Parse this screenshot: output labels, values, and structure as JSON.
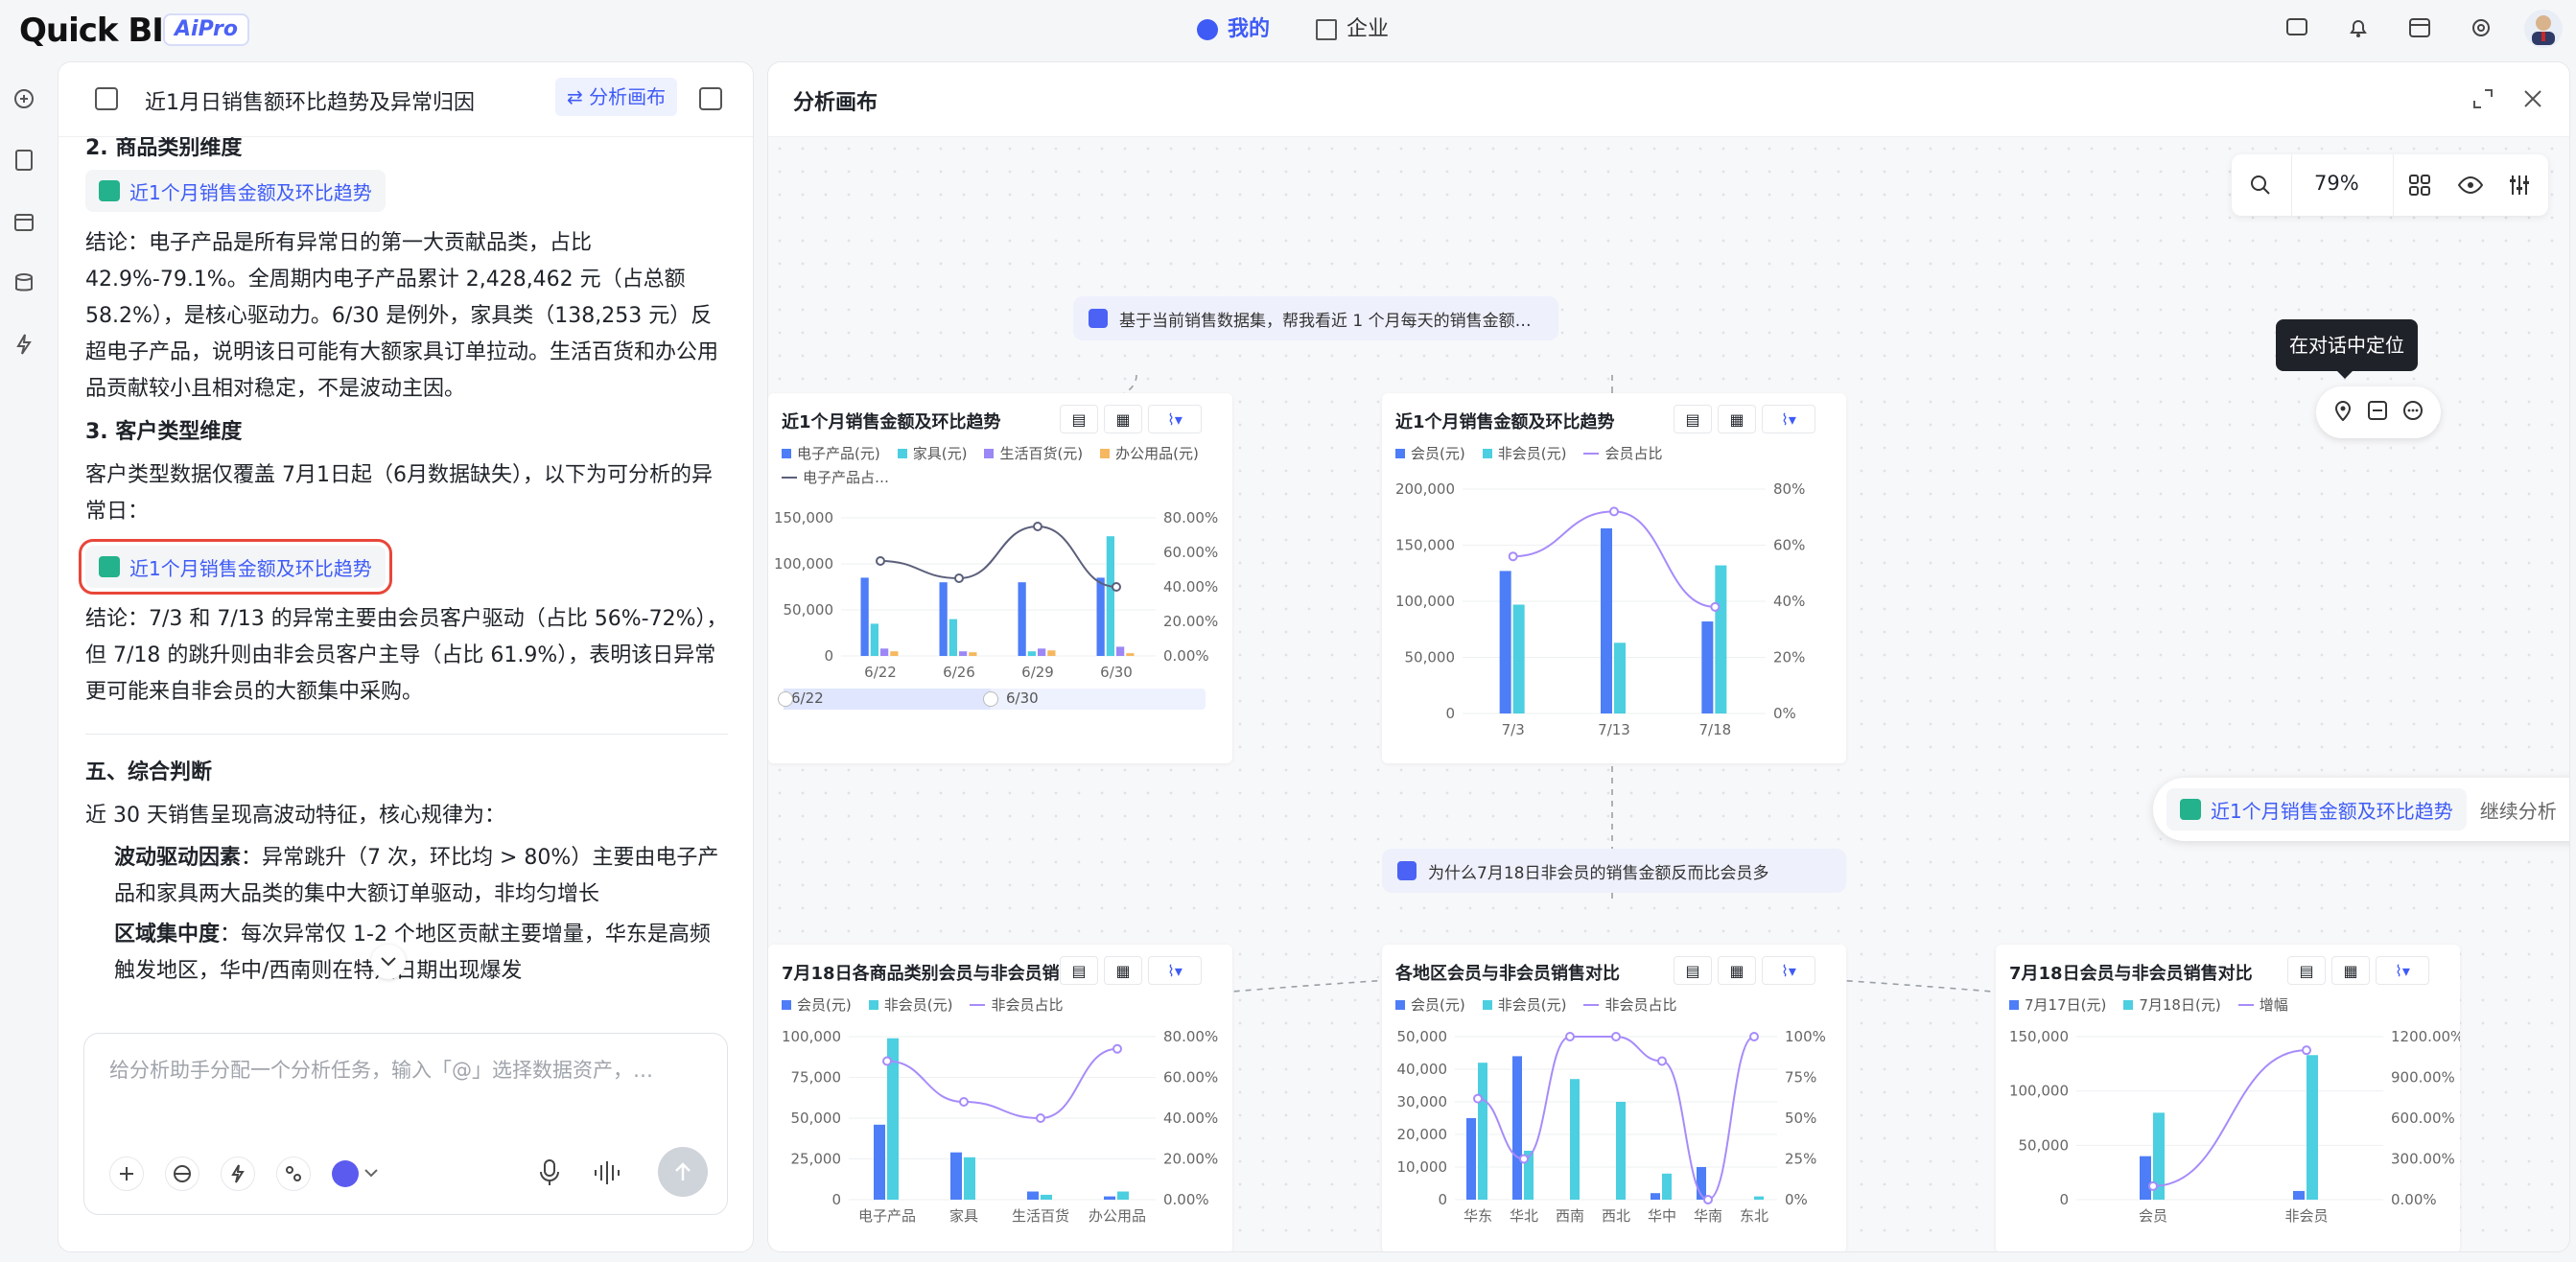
{
  "topbar": {
    "logo": "Quick BI",
    "badge": "AiPro",
    "tabs": [
      {
        "label": "我的",
        "active": true
      },
      {
        "label": "企业",
        "active": false
      }
    ],
    "colors": {
      "accent": "#3f5bf6"
    }
  },
  "chat": {
    "title": "近1月日销售额环比趋势及异常归因",
    "canvas_button": "分析画布",
    "sec2_heading": "2. 商品类别维度",
    "chip1": "近1个月销售金额及环比趋势",
    "p1": "结论：电子产品是所有异常日的第一大贡献品类，占比 42.9%-79.1%。全周期内电子产品累计 2,428,462 元（占总额 58.2%），是核心驱动力。6/30 是例外，家具类（138,253 元）反超电子产品，说明该日可能有大额家具订单拉动。生活百货和办公用品贡献较小且相对稳定，不是波动主因。",
    "sec3_heading": "3. 客户类型维度",
    "p2": "客户类型数据仅覆盖 7月1日起（6月数据缺失），以下为可分析的异常日：",
    "chip2": "近1个月销售金额及环比趋势",
    "p3": "结论：7/3 和 7/13 的异常主要由会员客户驱动（占比 56%-72%），但 7/18 的跳升则由非会员客户主导（占比 61.9%），表明该日异常更可能来自非会员的大额集中采购。",
    "sec5_heading": "五、综合判断",
    "p4": "近 30 天销售呈现高波动特征，核心规律为：",
    "b1_label": "波动驱动因素",
    "b1_text": "：异常跳升（7 次，环比均 > 80%）主要由电子产品和家具两大品类的集中大额订单驱动，非均匀增长",
    "b2_label": "区域集中度",
    "b2_text": "：每次异常仅 1-2 个地区贡献主要增量，华东是高频触发地区，华中/西南则在特定日期出现爆发",
    "input_placeholder": "给分析助手分配一个分析任务，输入「@」选择数据资产，…"
  },
  "canvas": {
    "title": "分析画布",
    "zoom": "79%",
    "tooltip": "在对话中定位",
    "q1": "基于当前销售数据集，帮我看近 1 个月每天的销售金额…",
    "q2": "为什么7月18日非会员的销售金额反而比会员多",
    "continue_chip": "近1个月销售金额及环比趋势",
    "continue_label": "继续分析",
    "card1": {
      "title": "近1个月销售金额及环比趋势",
      "legend": [
        "电子产品(元)",
        "家具(元)",
        "生活百货(元)",
        "办公用品(元)",
        "电子产品占…"
      ],
      "slider_start": "6/22",
      "slider_end": "6/30"
    },
    "card2": {
      "title": "近1个月销售金额及环比趋势",
      "legend": [
        "会员(元)",
        "非会员(元)",
        "会员占比"
      ]
    },
    "card3": {
      "title": "7月18日各商品类别会员与非会员销售…",
      "legend": [
        "会员(元)",
        "非会员(元)",
        "非会员占比"
      ]
    },
    "card4": {
      "title": "各地区会员与非会员销售对比",
      "legend": [
        "会员(元)",
        "非会员(元)",
        "非会员占比"
      ]
    },
    "card5": {
      "title": "7月18日会员与非会员销售对比",
      "legend": [
        "7月17日(元)",
        "7月18日(元)",
        "增幅"
      ]
    }
  },
  "chart_data": [
    {
      "type": "bar",
      "title": "近1个月销售金额及环比趋势",
      "categories": [
        "6/22",
        "6/26",
        "6/29",
        "6/30"
      ],
      "series": [
        {
          "name": "电子产品(元)",
          "values": [
            85000,
            80000,
            80000,
            85000
          ]
        },
        {
          "name": "家具(元)",
          "values": [
            35000,
            40000,
            5000,
            130000
          ]
        },
        {
          "name": "生活百货(元)",
          "values": [
            8000,
            5000,
            8000,
            10000
          ]
        },
        {
          "name": "办公用品(元)",
          "values": [
            5000,
            4000,
            6000,
            3000
          ]
        }
      ],
      "line": {
        "name": "电子产品占…",
        "values": [
          0.55,
          0.45,
          0.75,
          0.4
        ]
      },
      "y_left_ticks": [
        "150,000",
        "100,000",
        "50,000",
        "0"
      ],
      "y_right_ticks": [
        "80.00%",
        "60.00%",
        "40.00%",
        "20.00%",
        "0.00%"
      ],
      "ylim": [
        0,
        150000
      ]
    },
    {
      "type": "bar",
      "title": "近1个月销售金额及环比趋势",
      "categories": [
        "7/3",
        "7/13",
        "7/18"
      ],
      "series": [
        {
          "name": "会员(元)",
          "values": [
            127000,
            165000,
            82000
          ]
        },
        {
          "name": "非会员(元)",
          "values": [
            97000,
            63000,
            132000
          ]
        }
      ],
      "line": {
        "name": "会员占比",
        "values": [
          0.56,
          0.72,
          0.38
        ]
      },
      "y_left_ticks": [
        "200,000",
        "150,000",
        "100,000",
        "50,000",
        "0"
      ],
      "y_right_ticks": [
        "80%",
        "60%",
        "40%",
        "20%",
        "0%"
      ],
      "ylim": [
        0,
        200000
      ]
    },
    {
      "type": "bar",
      "title": "7月18日各商品类别会员与非会员销售…",
      "categories": [
        "电子产品",
        "家具",
        "生活百货",
        "办公用品"
      ],
      "series": [
        {
          "name": "会员(元)",
          "values": [
            46000,
            29000,
            5000,
            2000
          ]
        },
        {
          "name": "非会员(元)",
          "values": [
            99000,
            26000,
            3000,
            5000
          ]
        }
      ],
      "line": {
        "name": "非会员占比",
        "values": [
          0.68,
          0.48,
          0.4,
          0.74
        ]
      },
      "y_left_ticks": [
        "100,000",
        "75,000",
        "50,000",
        "25,000",
        "0"
      ],
      "y_right_ticks": [
        "80.00%",
        "60.00%",
        "40.00%",
        "20.00%",
        "0.00%"
      ],
      "ylim": [
        0,
        100000
      ]
    },
    {
      "type": "bar",
      "title": "各地区会员与非会员销售对比",
      "categories": [
        "华东",
        "华北",
        "西南",
        "西北",
        "华中",
        "华南",
        "东北"
      ],
      "series": [
        {
          "name": "会员(元)",
          "values": [
            25000,
            44000,
            0,
            0,
            2000,
            10000,
            0
          ]
        },
        {
          "name": "非会员(元)",
          "values": [
            42000,
            15000,
            37000,
            30000,
            8000,
            0,
            1000
          ]
        }
      ],
      "line": {
        "name": "非会员占比",
        "values": [
          0.62,
          0.25,
          1.0,
          1.0,
          0.85,
          0.0,
          1.0
        ]
      },
      "y_left_ticks": [
        "50,000",
        "40,000",
        "30,000",
        "20,000",
        "10,000",
        "0"
      ],
      "y_right_ticks": [
        "100%",
        "75%",
        "50%",
        "25%",
        "0%"
      ],
      "ylim": [
        0,
        50000
      ]
    },
    {
      "type": "bar",
      "title": "7月18日会员与非会员销售对比",
      "categories": [
        "会员",
        "非会员"
      ],
      "series": [
        {
          "name": "7月17日(元)",
          "values": [
            40000,
            8000
          ]
        },
        {
          "name": "7月18日(元)",
          "values": [
            80000,
            133000
          ]
        }
      ],
      "line": {
        "name": "增幅",
        "values": [
          1.0,
          11.0
        ]
      },
      "y_left_ticks": [
        "150,000",
        "100,000",
        "50,000",
        "0"
      ],
      "y_right_ticks": [
        "1200.00%",
        "900.00%",
        "600.00%",
        "300.00%",
        "0.00%"
      ],
      "ylim": [
        0,
        150000
      ]
    }
  ]
}
